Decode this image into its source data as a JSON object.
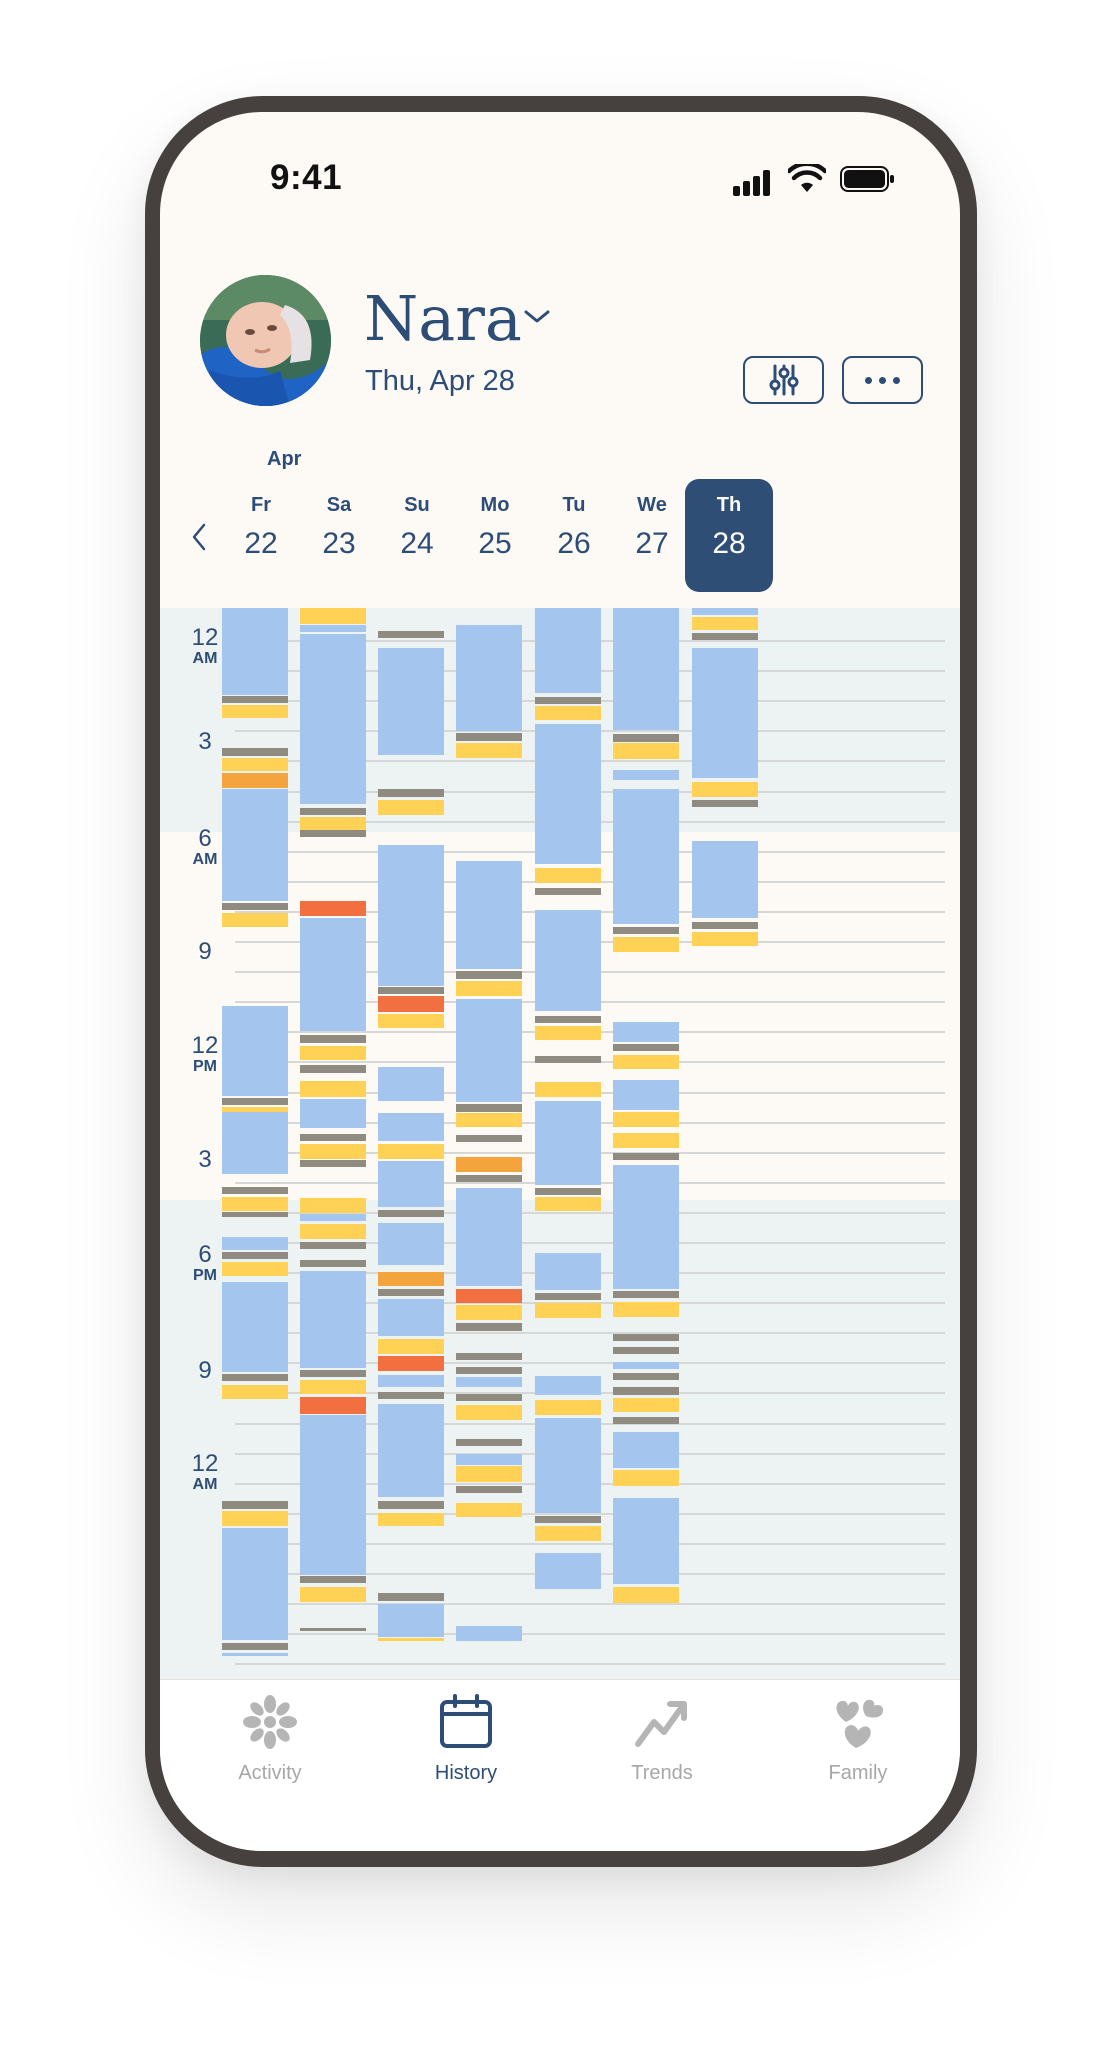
{
  "status_bar": {
    "time": "9:41"
  },
  "header": {
    "name": "Nara",
    "date": "Thu, Apr 28"
  },
  "days_row": {
    "month": "Apr",
    "days": [
      {
        "weekday": "Fr",
        "date": "22",
        "selected": false
      },
      {
        "weekday": "Sa",
        "date": "23",
        "selected": false
      },
      {
        "weekday": "Su",
        "date": "24",
        "selected": false
      },
      {
        "weekday": "Mo",
        "date": "25",
        "selected": false
      },
      {
        "weekday": "Tu",
        "date": "26",
        "selected": false
      },
      {
        "weekday": "We",
        "date": "27",
        "selected": false
      },
      {
        "weekday": "Th",
        "date": "28",
        "selected": true
      }
    ]
  },
  "hour_labels": [
    {
      "num": "12",
      "suffix": "AM"
    },
    {
      "num": "3",
      "suffix": ""
    },
    {
      "num": "6",
      "suffix": "AM"
    },
    {
      "num": "9",
      "suffix": ""
    },
    {
      "num": "12",
      "suffix": "PM"
    },
    {
      "num": "3",
      "suffix": ""
    },
    {
      "num": "6",
      "suffix": "PM"
    },
    {
      "num": "9",
      "suffix": ""
    },
    {
      "num": "12",
      "suffix": "AM"
    }
  ],
  "colors": {
    "sleep": "#a3c5ee",
    "feed": "#ffd255",
    "diaper": "#8f8b80",
    "pump": "#f3a43c",
    "alert": "#f26f3f",
    "night_band": "#edf2f3",
    "day_band": "#fdfaf6",
    "accent": "#2d4d77"
  },
  "tabs": [
    {
      "label": "Activity",
      "icon": "activity-icon",
      "active": false
    },
    {
      "label": "History",
      "icon": "calendar-icon",
      "active": true
    },
    {
      "label": "Trends",
      "icon": "trends-icon",
      "active": false
    },
    {
      "label": "Family",
      "icon": "hearts-icon",
      "active": false
    }
  ]
}
